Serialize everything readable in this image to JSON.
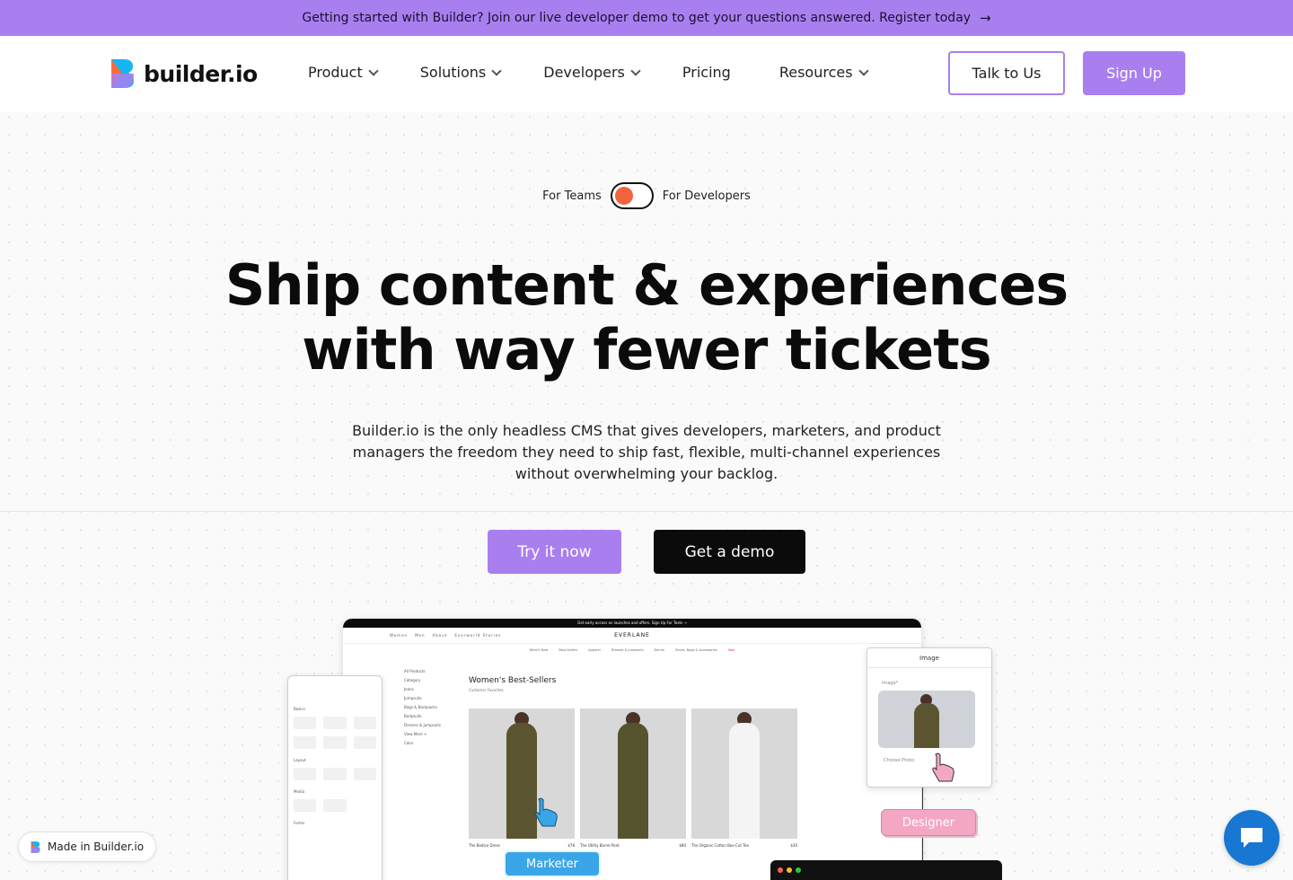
{
  "banner": {
    "text": "Getting started with Builder? Join our live developer demo to get your questions answered. Register today",
    "arrow": "→"
  },
  "nav": {
    "logo_text": "builder.io",
    "menu": [
      {
        "label": "Product",
        "has_dropdown": true
      },
      {
        "label": "Solutions",
        "has_dropdown": true
      },
      {
        "label": "Developers",
        "has_dropdown": true
      },
      {
        "label": "Pricing",
        "has_dropdown": false
      },
      {
        "label": "Resources",
        "has_dropdown": true
      }
    ],
    "talk_label": "Talk to Us",
    "signup_label": "Sign Up"
  },
  "toggle": {
    "left_label": "For Teams",
    "right_label": "For Developers",
    "knob_color": "#f2643e"
  },
  "hero": {
    "title_line1": "Ship content & experiences",
    "title_line2": "with way fewer tickets",
    "subtitle": "Builder.io is the only headless CMS that gives developers, marketers, and product managers the freedom they need to ship fast, flexible, multi-channel experiences without overwhelming your backlog."
  },
  "cta": {
    "try_label": "Try it now",
    "demo_label": "Get a demo"
  },
  "preview": {
    "store_top_text": "Get early access on launches and offers. Sign Up For Texts →",
    "store_brand": "EVERLANE",
    "store_links": [
      "Women",
      "Men",
      "About",
      "Everworld Stories"
    ],
    "store_subnav": [
      "What's New",
      "Best-Sellers",
      "Apparel",
      "Dresses & Jumpsuits",
      "Denim",
      "Shoes, Bags & Accessories",
      "Sale"
    ],
    "filter_heading": "All Products",
    "filters": [
      "Category",
      "Jeans",
      "Jumpsuits",
      "Bags & Backpacks",
      "Bodysuits",
      "Dresses & Jumpsuits",
      "View More +",
      "Color"
    ],
    "category_title": "Women's Best-Sellers",
    "category_sub": "Customer Favorites",
    "products": [
      {
        "name": "The Bodice Dress",
        "price": "$78",
        "fig_color": "#5a5530"
      },
      {
        "name": "The Utility Barrel Pant",
        "price": "$80",
        "fig_color": "#55542e"
      },
      {
        "name": "The Organic Cotton Box-Cut Tee",
        "price": "$30",
        "fig_color": "#f4f4f4"
      }
    ],
    "mobile_sections": [
      "Basics",
      "Layout",
      "Media",
      "Forms"
    ],
    "image_panel_title": "Image",
    "image_label": "Image*",
    "choose_photo": "Choose Photo",
    "designer_label": "Designer",
    "marketer_label": "Marketer"
  },
  "made_in": "Made in Builder.io",
  "colors": {
    "accent": "#a97ff0",
    "chat": "#1877d2"
  }
}
